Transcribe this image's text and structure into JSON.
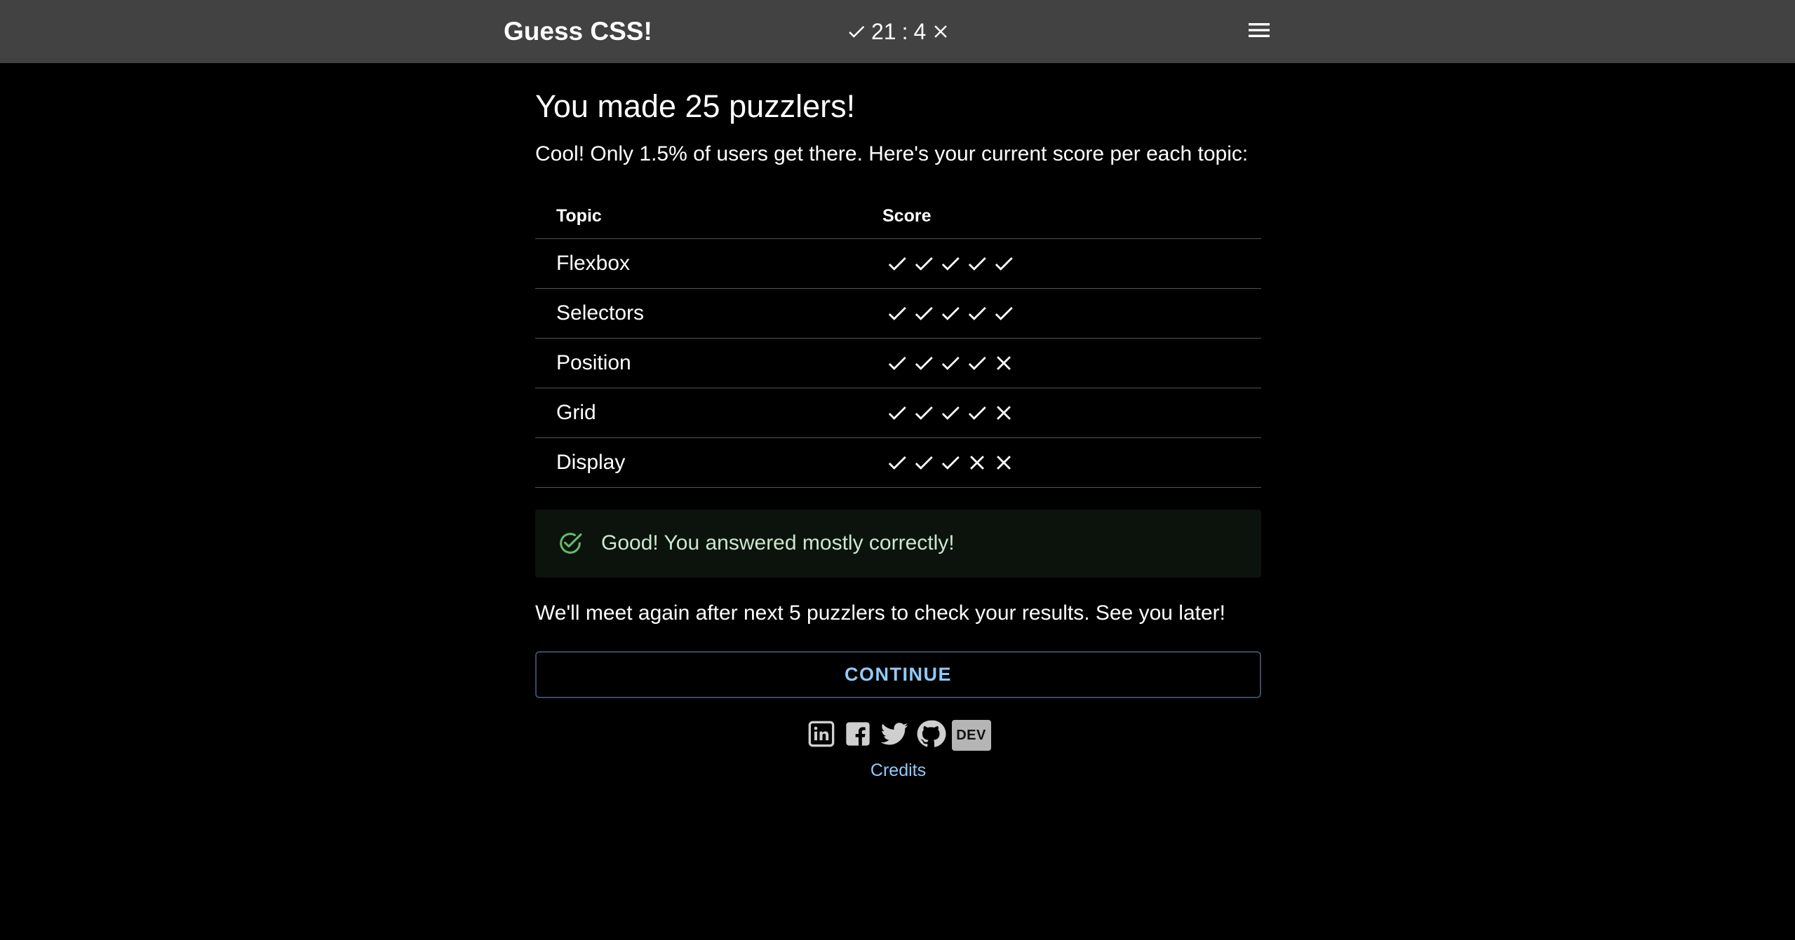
{
  "header": {
    "title": "Guess CSS!",
    "correct_count": "21",
    "separator": ":",
    "wrong_count": "4",
    "menu_icon": "hamburger-menu-icon"
  },
  "result": {
    "title": "You made 25 puzzlers!",
    "subtitle": "Cool! Only 1.5% of users get there. Here's your current score per each topic:"
  },
  "table": {
    "headers": {
      "topic": "Topic",
      "score": "Score"
    },
    "rows": [
      {
        "topic": "Flexbox",
        "correct": 5,
        "total": 5
      },
      {
        "topic": "Selectors",
        "correct": 5,
        "total": 5
      },
      {
        "topic": "Position",
        "correct": 4,
        "total": 5
      },
      {
        "topic": "Grid",
        "correct": 4,
        "total": 5
      },
      {
        "topic": "Display",
        "correct": 3,
        "total": 5
      }
    ]
  },
  "alert": {
    "text": "Good! You answered mostly correctly!",
    "icon": "check-circle-icon",
    "color": "#66bb6a"
  },
  "followup": "We'll meet again after next 5 puzzlers to check your results. See you later!",
  "continue_label": "CONTINUE",
  "social": {
    "items": [
      "linkedin-icon",
      "facebook-icon",
      "twitter-icon",
      "github-icon",
      "dev-icon"
    ],
    "dev_label": "DEV"
  },
  "credits_label": "Credits",
  "colors": {
    "app_bar": "#424242",
    "background": "#000000",
    "link": "#90caf9",
    "success": "#66bb6a"
  }
}
